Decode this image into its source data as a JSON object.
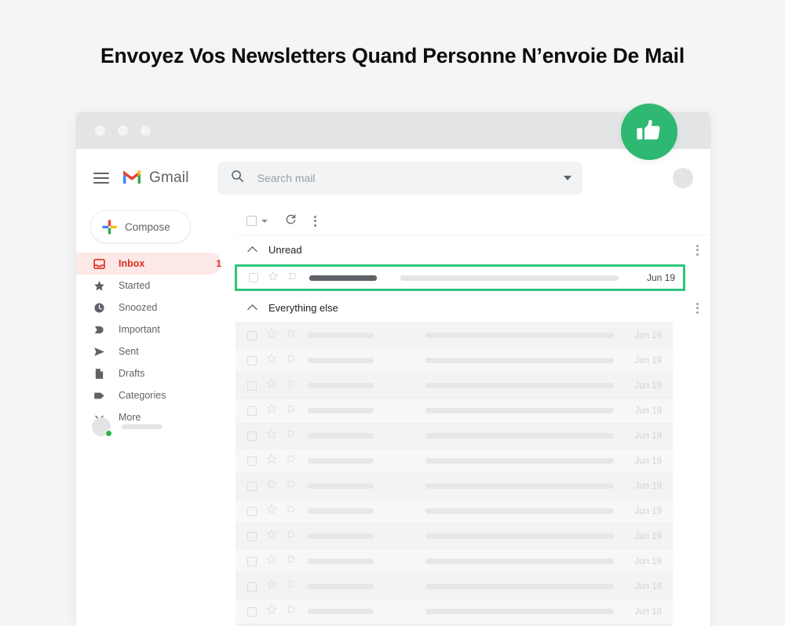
{
  "headline": "Envoyez Vos Newsletters Quand Personne N’envoie De Mail",
  "window": {
    "dots": [
      "window-dot",
      "window-dot",
      "window-dot"
    ]
  },
  "header": {
    "menu_icon": "hamburger-icon",
    "logo_icon": "gmail-logo-icon",
    "brand": "Gmail",
    "search": {
      "icon": "search-icon",
      "placeholder": "Search mail",
      "value": "",
      "dropdown_icon": "chevron-down-icon"
    },
    "avatar_icon": "account-avatar"
  },
  "sidebar": {
    "compose": {
      "label": "Compose",
      "icon": "plus-icon"
    },
    "items": [
      {
        "label": "Inbox",
        "icon": "inbox-icon",
        "count": "1",
        "active": true
      },
      {
        "label": "Started",
        "icon": "star-icon",
        "count": "",
        "active": false
      },
      {
        "label": "Snoozed",
        "icon": "clock-icon",
        "count": "",
        "active": false
      },
      {
        "label": "Important",
        "icon": "important-icon",
        "count": "",
        "active": false
      },
      {
        "label": "Sent",
        "icon": "send-icon",
        "count": "",
        "active": false
      },
      {
        "label": "Drafts",
        "icon": "draft-icon",
        "count": "",
        "active": false
      },
      {
        "label": "Categories",
        "icon": "label-icon",
        "count": "",
        "active": false
      },
      {
        "label": "More",
        "icon": "chevron-down-icon",
        "count": "",
        "active": false
      }
    ],
    "user": {
      "avatar_icon": "user-avatar",
      "status_icon": "online-status-dot"
    }
  },
  "toolbar": {
    "select_all_icon": "checkbox-icon",
    "select_caret_icon": "chevron-down-icon",
    "refresh_icon": "refresh-icon",
    "more_icon": "more-vertical-icon"
  },
  "sections": [
    {
      "title": "Unread",
      "collapse_icon": "chevron-up-icon",
      "more_icon": "more-vertical-icon",
      "rows": [
        {
          "date": "Jun 19",
          "highlighted": true
        }
      ]
    },
    {
      "title": "Everything else",
      "collapse_icon": "chevron-up-icon",
      "more_icon": "more-vertical-icon",
      "rows": [
        {
          "date": "Jun 19",
          "highlighted": false
        },
        {
          "date": "Jun 19",
          "highlighted": false
        },
        {
          "date": "Jun 19",
          "highlighted": false
        },
        {
          "date": "Jun 19",
          "highlighted": false
        },
        {
          "date": "Jun 19",
          "highlighted": false
        },
        {
          "date": "Jun 19",
          "highlighted": false
        },
        {
          "date": "Jun 19",
          "highlighted": false
        },
        {
          "date": "Jun 19",
          "highlighted": false
        },
        {
          "date": "Jun 19",
          "highlighted": false
        },
        {
          "date": "Jun 19",
          "highlighted": false
        },
        {
          "date": "Jun 18",
          "highlighted": false
        },
        {
          "date": "Jun 18",
          "highlighted": false
        }
      ]
    }
  ],
  "badge": {
    "icon": "thumbs-up-icon"
  },
  "colors": {
    "page_bg": "#f5f5f5",
    "accent_green": "#2ec77e",
    "badge_green": "#2eb872",
    "inbox_active_bg": "#fce8e6",
    "inbox_active_text": "#d93025",
    "titlebar": "#e2e4e5",
    "search_bg": "#f1f3f4",
    "status_green": "#2bb24c"
  }
}
